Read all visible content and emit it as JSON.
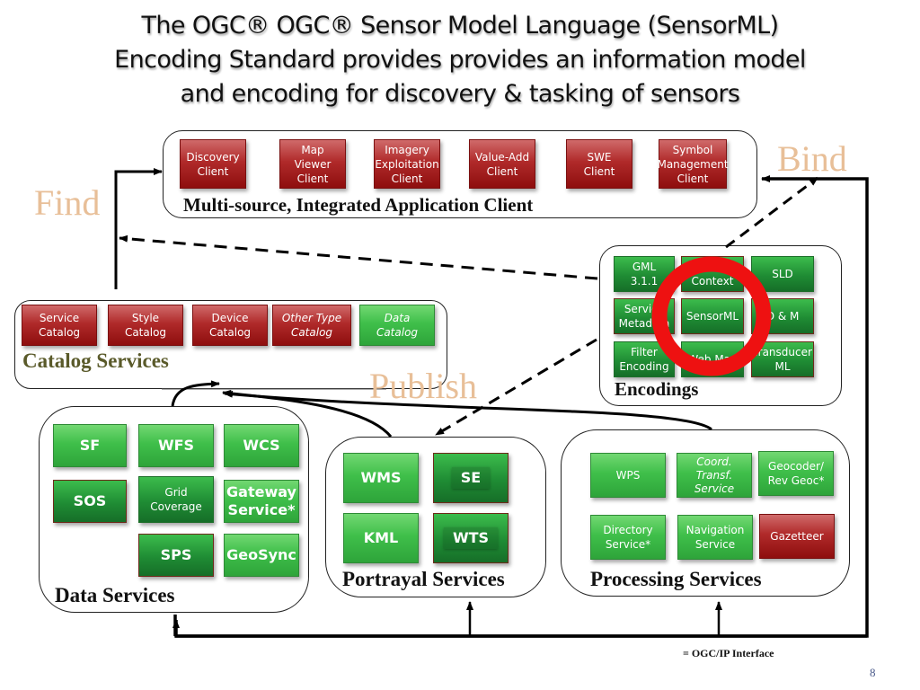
{
  "title": {
    "line1": "The OGC® OGC® Sensor Model Language (SensorML)",
    "line2": "Encoding Standard provides provides an information model",
    "line3": "and encoding for discovery & tasking of sensors"
  },
  "actions": {
    "find": "Find",
    "bind": "Bind",
    "publish": "Publish"
  },
  "colors": {
    "red_box": "#a81e1e",
    "green_box": "#3fbf4a",
    "dark_green_box": "#1f8c34",
    "action_text": "#e8bf98",
    "highlight_circle": "#ee1111"
  },
  "client_group": {
    "label": "Multi-source, Integrated Application Client",
    "items": [
      {
        "label": "Discovery\nClient"
      },
      {
        "label": "Map Viewer\nClient"
      },
      {
        "label": "Imagery\nExploitation\nClient"
      },
      {
        "label": "Value-Add\nClient"
      },
      {
        "label": "SWE\nClient"
      },
      {
        "label": "Symbol\nManagement\nClient"
      }
    ]
  },
  "catalog_group": {
    "label": "Catalog Services",
    "items": [
      {
        "label": "Service\nCatalog"
      },
      {
        "label": "Style\nCatalog"
      },
      {
        "label": "Device\nCatalog"
      },
      {
        "label": "Other Type\nCatalog"
      },
      {
        "label": "Data\nCatalog"
      }
    ]
  },
  "encodings_group": {
    "label": "Encodings",
    "items": [
      {
        "label": "GML\n3.1.1"
      },
      {
        "label": "Open Web\nContext"
      },
      {
        "label": "SLD"
      },
      {
        "label": "Service\nMetadata"
      },
      {
        "label": "SensorML"
      },
      {
        "label": "O & M"
      },
      {
        "label": "Filter\nEncoding"
      },
      {
        "label": "Web Map"
      },
      {
        "label": "Transducer\nML"
      }
    ]
  },
  "data_group": {
    "label": "Data Services",
    "items": [
      {
        "label": "SF"
      },
      {
        "label": "WFS"
      },
      {
        "label": "WCS"
      },
      {
        "label": "SOS"
      },
      {
        "label": "Grid\nCoverage"
      },
      {
        "label": "Gateway\nService*"
      },
      {
        "label": "SPS"
      },
      {
        "label": "GeoSync"
      }
    ]
  },
  "portrayal_group": {
    "label": "Portrayal Services",
    "items": [
      {
        "label": "WMS"
      },
      {
        "label": "SE"
      },
      {
        "label": "KML"
      },
      {
        "label": "WTS"
      }
    ]
  },
  "processing_group": {
    "label": "Processing Services",
    "items": [
      {
        "label": "WPS"
      },
      {
        "label": "Coord.\nTransf.\nService"
      },
      {
        "label": "Geocoder/\nRev Geoc*"
      },
      {
        "label": "Directory\nService*"
      },
      {
        "label": "Navigation\nService"
      },
      {
        "label": "Gazetteer"
      }
    ]
  },
  "legend": "= OGC/IP Interface",
  "page_number": "8"
}
